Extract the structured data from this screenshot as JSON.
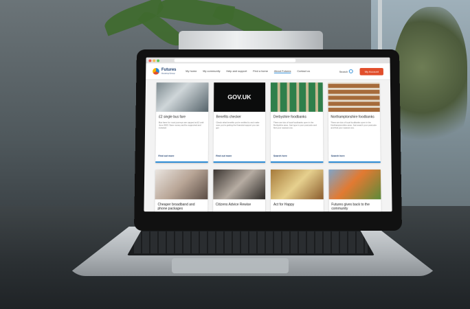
{
  "site": {
    "logo_name": "Futures",
    "logo_sub": "Housing Group",
    "nav": [
      "My home",
      "My community",
      "Help and support",
      "Find a home",
      "About Futures",
      "Contact us"
    ],
    "active_nav_index": 4,
    "search_label": "Search",
    "account_label": "My Account",
    "colors": {
      "accent": "#e14e2b",
      "brand": "#1b3d6e",
      "link": "#2a8bd6"
    }
  },
  "cards": [
    {
      "title": "£2 single bus fare",
      "text": "Bus fares for most journeys are capped at £2 until June 2023. Save money and be supported and included.",
      "link": "Find out more"
    },
    {
      "title": "Benefits checker",
      "text": "Check what benefits you're entitled to and make sure you're getting the financial support you can get.",
      "link": "Find out more",
      "image_text": "GOV.UK"
    },
    {
      "title": "Derbyshire foodbanks",
      "text": "There are lots of local foodbanks open in the Derbyshire area. Just type in your postcode and find your nearest one.",
      "link": "Search here"
    },
    {
      "title": "Northamptonshire foodbanks",
      "text": "There are lots of local foodbanks open in the Northamptonshire area. Just search your postcode and find your nearest one.",
      "link": "Search here"
    },
    {
      "title": "Cheaper broadband and phone packages",
      "text": "",
      "link": ""
    },
    {
      "title": "Citizens Advice Rewise",
      "text": "",
      "link": ""
    },
    {
      "title": "Act for Happy",
      "text": "",
      "link": ""
    },
    {
      "title": "Futures gives back to the community",
      "text": "",
      "link": ""
    }
  ]
}
